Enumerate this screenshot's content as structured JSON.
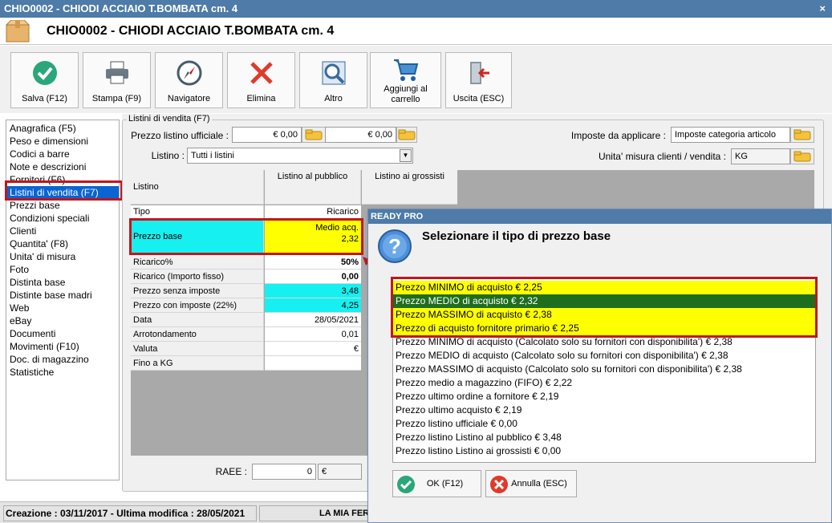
{
  "window": {
    "title": "CHIO0002 - CHIODI ACCIAIO T.BOMBATA cm. 4",
    "close": "×"
  },
  "header": {
    "title": "CHIO0002 - CHIODI ACCIAIO T.BOMBATA cm. 4"
  },
  "toolbar": {
    "save": "Salva (F12)",
    "print": "Stampa (F9)",
    "navigator": "Navigatore",
    "delete": "Elimina",
    "other": "Altro",
    "cart_1": "Aggiungi al",
    "cart_2": "carrello",
    "exit": "Uscita (ESC)"
  },
  "sidebar": {
    "items": [
      "Anagrafica (F5)",
      "Peso e dimensioni",
      "Codici a barre",
      "Note e descrizioni",
      "Fornitori (F6)",
      "Listini di vendita (F7)",
      "Prezzi base",
      "Condizioni speciali",
      "Clienti",
      "Quantita' (F8)",
      "Unita' di misura",
      "Foto",
      "Distinta base",
      "Distinte base madri",
      "Web",
      "eBay",
      "Documenti",
      "Movimenti (F10)",
      "Doc. di magazzino",
      "Statistiche"
    ]
  },
  "form": {
    "group_label": "Listini di vendita (F7)",
    "official_price_label": "Prezzo listino ufficiale :",
    "official_price_1": "€ 0,00",
    "official_price_2": "€ 0,00",
    "pricelist_label": "Listino :",
    "pricelist_value": "Tutti i listini",
    "taxes_label": "Imposte da applicare :",
    "taxes_value": "Imposte categoria articolo",
    "uom_label": "Unita' misura clienti / vendita :",
    "uom_value": "KG",
    "raee_label": "RAEE :",
    "raee_value": "0",
    "raee_currency": "€"
  },
  "grid": {
    "corner": "Listino",
    "col_public": "Listino al pubblico",
    "col_wholesale": "Listino ai grossisti",
    "rows": {
      "tipo": {
        "label": "Tipo",
        "value": "Ricarico"
      },
      "prezzo_base": {
        "label": "Prezzo base",
        "value_1": "Medio acq.",
        "value_2": "2,32"
      },
      "ricarico_pct": {
        "label": "Ricarico%",
        "value": "50%"
      },
      "ricarico_fisso": {
        "label": "Ricarico (Importo fisso)",
        "value": "0,00"
      },
      "senza_imposte": {
        "label": "Prezzo senza imposte",
        "value": "3,48"
      },
      "con_imposte": {
        "label": "Prezzo con imposte (22%)",
        "value": "4,25"
      },
      "data": {
        "label": "Data",
        "value": "28/05/2021"
      },
      "arrotondamento": {
        "label": "Arrotondamento",
        "value": "0,01"
      },
      "valuta": {
        "label": "Valuta",
        "value": "€"
      },
      "fino_kg": {
        "label": "Fino a KG",
        "value": ""
      }
    }
  },
  "status": {
    "dates": "Creazione : 03/11/2017 - Ultima modifica : 28/05/2021",
    "company": "LA MIA FER"
  },
  "dialog": {
    "title": "READY PRO",
    "heading": "Selezionare il tipo di prezzo base",
    "options": [
      "Prezzo MINIMO di acquisto € 2,25",
      "Prezzo MEDIO di acquisto € 2,32",
      "Prezzo MASSIMO di acquisto € 2,38",
      "Prezzo di acquisto fornitore primario € 2,25",
      "Prezzo MINIMO di acquisto (Calcolato solo su fornitori con disponibilita') € 2,38",
      "Prezzo MEDIO di acquisto (Calcolato solo su fornitori con disponibilita') € 2,38",
      "Prezzo MASSIMO di acquisto (Calcolato solo su fornitori con disponibilita') € 2,38",
      "Prezzo medio a magazzino (FIFO) € 2,22",
      "Prezzo ultimo ordine a fornitore € 2,19",
      "Prezzo ultimo acquisto € 2,19",
      "Prezzo listino ufficiale € 0,00",
      "Prezzo listino Listino al pubblico € 3,48",
      "Prezzo listino Listino ai grossisti € 0,00"
    ],
    "ok": "OK (F12)",
    "cancel": "Annulla (ESC)"
  },
  "colors": {
    "accent": "#4e7ba8",
    "selection": "#0a64d2",
    "highlight_red": "#c0161c",
    "yellow": "#ffff00",
    "cyan": "#16f0f0",
    "green_sel": "#1e6e1e"
  }
}
